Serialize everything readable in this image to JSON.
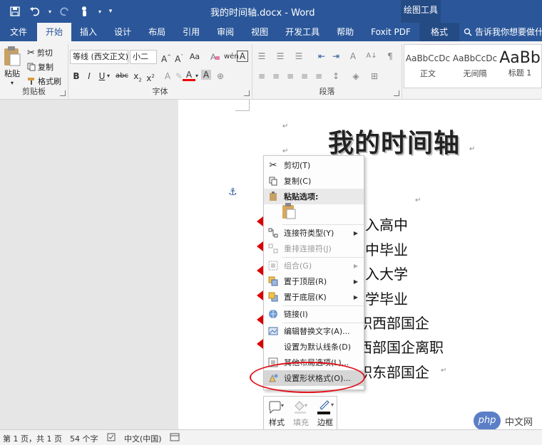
{
  "window": {
    "title": "我的时间轴.docx - Word",
    "context_tab_group": "绘图工具"
  },
  "tabs": [
    {
      "label": "文件"
    },
    {
      "label": "开始"
    },
    {
      "label": "插入"
    },
    {
      "label": "设计"
    },
    {
      "label": "布局"
    },
    {
      "label": "引用"
    },
    {
      "label": "审阅"
    },
    {
      "label": "视图"
    },
    {
      "label": "开发工具"
    },
    {
      "label": "帮助"
    },
    {
      "label": "Foxit PDF"
    },
    {
      "label": "格式"
    }
  ],
  "tell_me": "告诉我你想要做什么",
  "ribbon": {
    "clipboard": {
      "paste": "粘贴",
      "cut": "剪切",
      "copy": "复制",
      "format_painter": "格式刷",
      "label": "剪贴板"
    },
    "font": {
      "font_name": "等线 (西文正文)",
      "font_size": "小二",
      "label": "字体"
    },
    "paragraph": {
      "label": "段落"
    },
    "styles": [
      {
        "sample": "AaBbCcDc",
        "name": "正文"
      },
      {
        "sample": "AaBbCcDc",
        "name": "无间隔"
      },
      {
        "sample": "AaBb",
        "name": "标题 1"
      }
    ]
  },
  "document": {
    "heading": "我的时间轴",
    "items": [
      "考入高中",
      "高中毕业",
      "考入大学",
      "大学毕业",
      "入职西部国企",
      "入西部国企离职",
      "入职东部国企"
    ]
  },
  "context_menu": {
    "cut": "剪切(T)",
    "copy": "复制(C)",
    "paste_options": "粘贴选项:",
    "connector_type": "连接符类型(Y)",
    "reroute": "重排连接符(J)",
    "group": "组合(G)",
    "bring_front": "置于顶层(R)",
    "send_back": "置于底层(K)",
    "link": "链接(I)",
    "alt_text": "编辑替换文字(A)...",
    "default_line": "设置为默认线条(D)",
    "more_layout": "其他布局选项(L)...",
    "format_shape": "设置形状格式(O)..."
  },
  "mini_toolbar": {
    "style": "样式",
    "fill": "填充",
    "outline": "边框"
  },
  "status": {
    "page": "第 1 页，共 1 页",
    "words": "54 个字",
    "language": "中文(中国)"
  },
  "watermark": {
    "logo": "php",
    "text": "中文网"
  },
  "colors": {
    "brand": "#2b579a",
    "highlight": "#e0141d",
    "marker": "#dd0000"
  }
}
